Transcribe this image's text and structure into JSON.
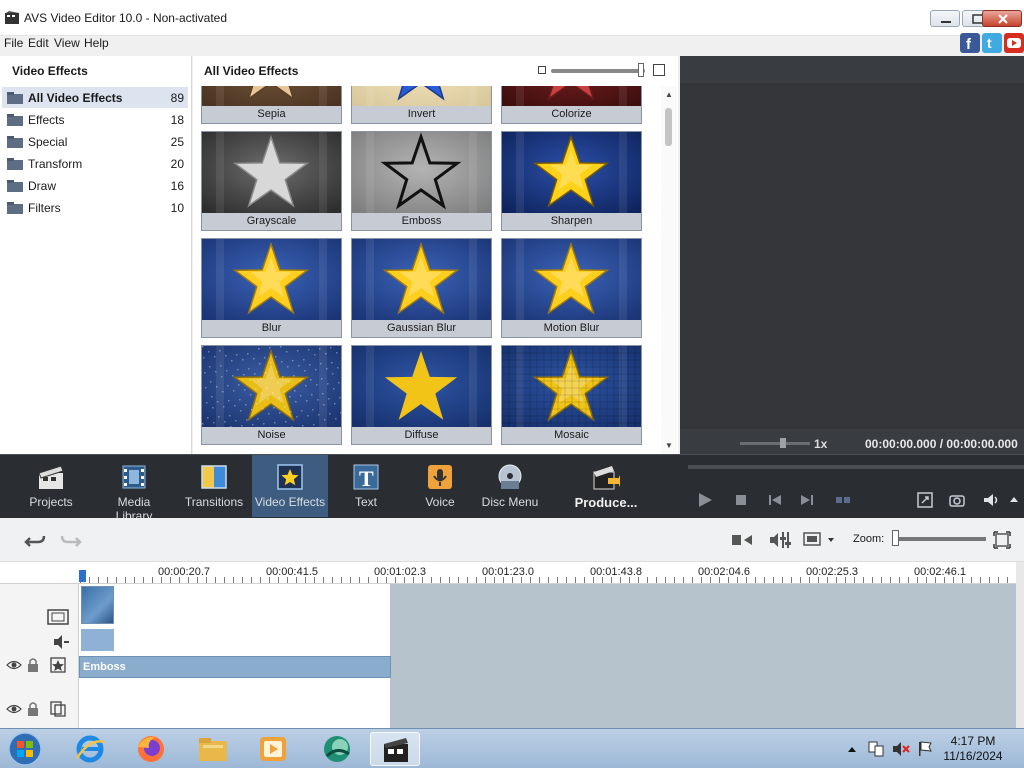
{
  "window": {
    "title": "AVS Video Editor 10.0 - Non-activated"
  },
  "menu": [
    "File",
    "Edit",
    "View",
    "Help"
  ],
  "social": [
    "facebook-icon",
    "twitter-icon",
    "youtube-icon"
  ],
  "left_panel": {
    "title": "Video Effects",
    "categories": [
      {
        "label": "All Video Effects",
        "count": "89"
      },
      {
        "label": "Effects",
        "count": "18"
      },
      {
        "label": "Special",
        "count": "25"
      },
      {
        "label": "Transform",
        "count": "20"
      },
      {
        "label": "Draw",
        "count": "16"
      },
      {
        "label": "Filters",
        "count": "10"
      }
    ]
  },
  "grid": {
    "title": "All Video Effects",
    "effects": [
      {
        "label": "Sepia",
        "style": "sepia"
      },
      {
        "label": "Invert",
        "style": "invert"
      },
      {
        "label": "Colorize",
        "style": "colorize"
      },
      {
        "label": "Grayscale",
        "style": "grayscale"
      },
      {
        "label": "Emboss",
        "style": "emboss"
      },
      {
        "label": "Sharpen",
        "style": "sharpen"
      },
      {
        "label": "Blur",
        "style": "blur"
      },
      {
        "label": "Gaussian Blur",
        "style": "gaussian"
      },
      {
        "label": "Motion Blur",
        "style": "motion"
      },
      {
        "label": "Noise",
        "style": "noise"
      },
      {
        "label": "Diffuse",
        "style": "diffuse"
      },
      {
        "label": "Mosaic",
        "style": "mosaic"
      }
    ]
  },
  "preview": {
    "speed": "1x",
    "timecode": "00:00:00.000  / 00:00:00.000"
  },
  "toolbar": {
    "tools": [
      {
        "label": "Projects",
        "icon": "clapperboard-icon"
      },
      {
        "label": "Media Library",
        "icon": "film-icon"
      },
      {
        "label": "Transitions",
        "icon": "transitions-icon"
      },
      {
        "label": "Video Effects",
        "icon": "video-effects-icon",
        "selected": true
      },
      {
        "label": "Text",
        "icon": "text-icon"
      },
      {
        "label": "Voice",
        "icon": "microphone-icon"
      },
      {
        "label": "Disc Menu",
        "icon": "disc-menu-icon"
      },
      {
        "label": "Produce...",
        "icon": "produce-icon"
      }
    ]
  },
  "timeline": {
    "zoom_label": "Zoom:",
    "ruler": [
      "00:00:20.7",
      "00:00:41.5",
      "00:01:02.3",
      "00:01:23.0",
      "00:01:43.8",
      "00:02:04.6",
      "00:02:25.3",
      "00:02:46.1"
    ],
    "effect_clip": "Emboss"
  },
  "taskbar": {
    "time": "4:17 PM",
    "date": "11/16/2024"
  }
}
